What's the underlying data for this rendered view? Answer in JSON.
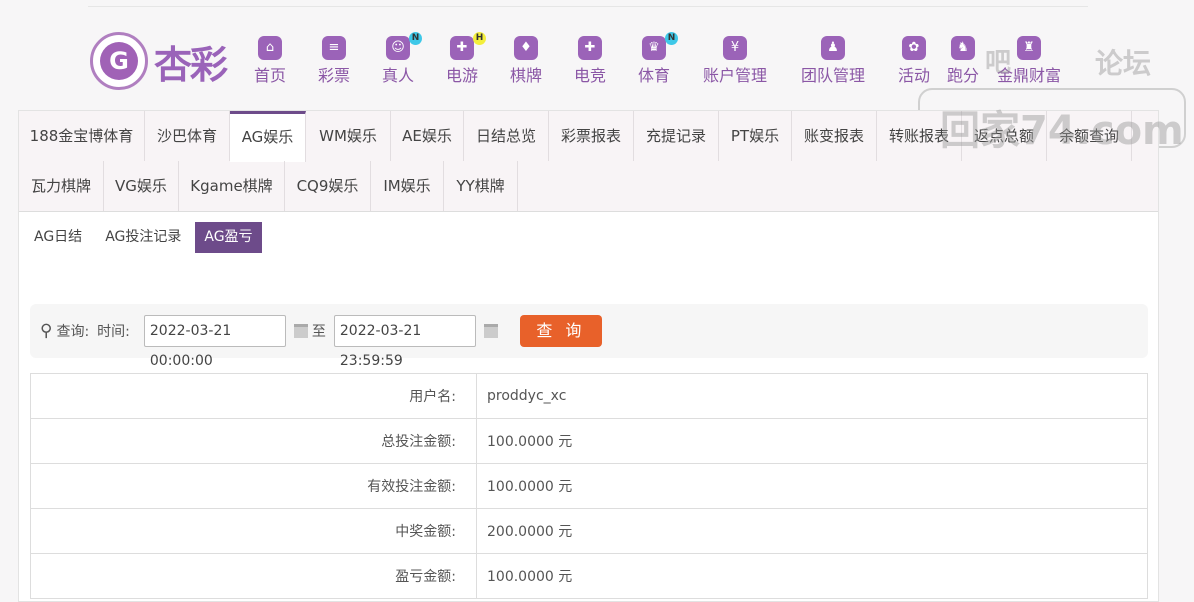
{
  "brand": {
    "logo_letter": "G",
    "name": "杏彩"
  },
  "nav": [
    {
      "label": "首页",
      "icon": "home-icon",
      "glyph": "⌂"
    },
    {
      "label": "彩票",
      "icon": "lottery-ticket-icon",
      "glyph": "≡"
    },
    {
      "label": "真人",
      "icon": "live-dealer-icon",
      "glyph": "☺",
      "badge": "N"
    },
    {
      "label": "电游",
      "icon": "gamepad-icon",
      "glyph": "✚",
      "badge": "H"
    },
    {
      "label": "棋牌",
      "icon": "cards-icon",
      "glyph": "♦"
    },
    {
      "label": "电竞",
      "icon": "esports-icon",
      "glyph": "✚"
    },
    {
      "label": "体育",
      "icon": "trophy-icon",
      "glyph": "♛",
      "badge": "N"
    },
    {
      "label": "账户管理",
      "icon": "yen-coin-icon",
      "glyph": "¥"
    },
    {
      "label": "团队管理",
      "icon": "team-icon",
      "glyph": "♟"
    },
    {
      "label": "活动",
      "icon": "gift-icon",
      "glyph": "✿"
    },
    {
      "label": "跑分",
      "icon": "run-score-icon",
      "glyph": "♞"
    },
    {
      "label": "金鼎财富",
      "icon": "wealth-icon",
      "glyph": "♜"
    }
  ],
  "watermark": {
    "line1": "吧",
    "line2": "论坛",
    "line3": "回家74.com"
  },
  "tabs_row1": [
    "188金宝博体育",
    "沙巴体育",
    "AG娱乐",
    "WM娱乐",
    "AE娱乐",
    "日结总览",
    "彩票报表",
    "充提记录",
    "PT娱乐",
    "账变报表",
    "转账报表",
    "返点总额",
    "余额查询"
  ],
  "tabs_row2": [
    "瓦力棋牌",
    "VG娱乐",
    "Kgame棋牌",
    "CQ9娱乐",
    "IM娱乐",
    "YY棋牌"
  ],
  "subtabs": [
    "AG日结",
    "AG投注记录",
    "AG盈亏"
  ],
  "search": {
    "query_label": "查询:",
    "time_label": "时间:",
    "start": "2022-03-21 00:00:00",
    "to": "至",
    "end": "2022-03-21 23:59:59",
    "button": "查 询"
  },
  "rows": [
    {
      "label": "用户名:",
      "value": "proddyc_xc"
    },
    {
      "label": "总投注金额:",
      "value": "100.0000 元"
    },
    {
      "label": "有效投注金额:",
      "value": "100.0000 元"
    },
    {
      "label": "中奖金额:",
      "value": "200.0000 元"
    },
    {
      "label": "盈亏金额:",
      "value": "100.0000 元"
    }
  ]
}
